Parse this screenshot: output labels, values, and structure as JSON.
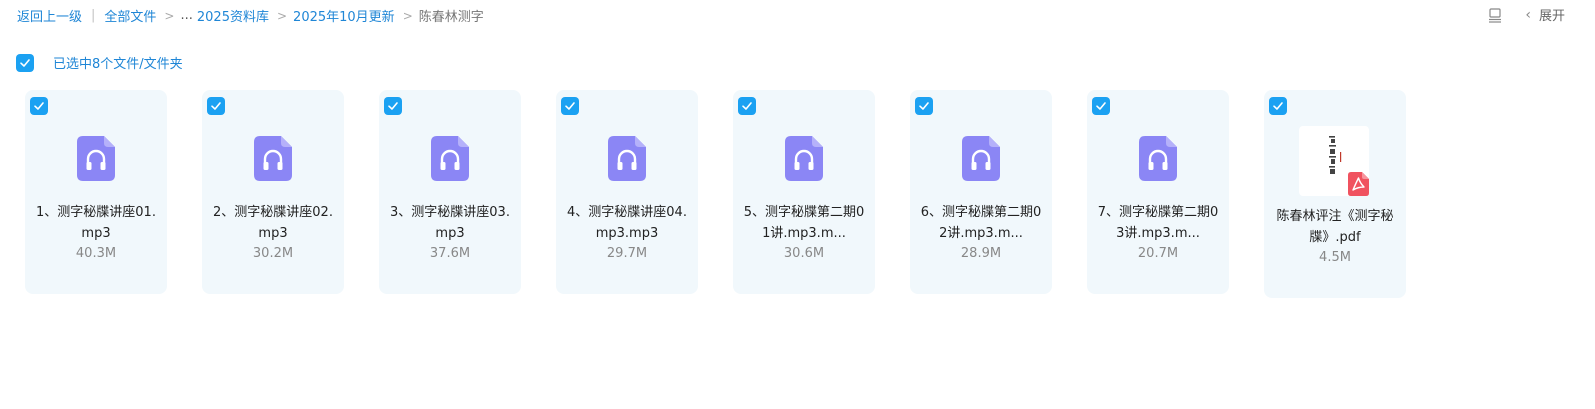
{
  "breadcrumb": {
    "back": "返回上一级",
    "all_files": "全部文件",
    "ellipsis": "...",
    "level1": "2025资料库",
    "level2": "2025年10月更新",
    "current": "陈春林测字"
  },
  "toolbar": {
    "expand_label": "展开",
    "list_view_icon": "list-view-icon",
    "chevron_icon": "chevron-left-icon"
  },
  "selection": {
    "text": "已选中8个文件/文件夹"
  },
  "colors": {
    "link": "#1f86d6",
    "checkbox": "#1ba1f2",
    "card_bg": "#f1f8fc",
    "audio_icon": "#8b86f5",
    "pdf_badge": "#f0525f"
  },
  "files": [
    {
      "name": "1、测字秘牒讲座01.mp3",
      "size": "40.3M",
      "type": "audio",
      "icon": "audio-file-icon"
    },
    {
      "name": "2、测字秘牒讲座02.mp3",
      "size": "30.2M",
      "type": "audio",
      "icon": "audio-file-icon"
    },
    {
      "name": "3、测字秘牒讲座03.mp3",
      "size": "37.6M",
      "type": "audio",
      "icon": "audio-file-icon"
    },
    {
      "name": "4、测字秘牒讲座04.mp3.mp3",
      "size": "29.7M",
      "type": "audio",
      "icon": "audio-file-icon"
    },
    {
      "name": "5、测字秘牒第二期01讲.mp3.m...",
      "size": "30.6M",
      "type": "audio",
      "icon": "audio-file-icon"
    },
    {
      "name": "6、测字秘牒第二期02讲.mp3.m...",
      "size": "28.9M",
      "type": "audio",
      "icon": "audio-file-icon"
    },
    {
      "name": "7、测字秘牒第二期03讲.mp3.m...",
      "size": "20.7M",
      "type": "audio",
      "icon": "audio-file-icon"
    },
    {
      "name": "陈春林评注《测字秘牒》.pdf",
      "size": "4.5M",
      "type": "pdf",
      "icon": "pdf-file-icon"
    }
  ]
}
